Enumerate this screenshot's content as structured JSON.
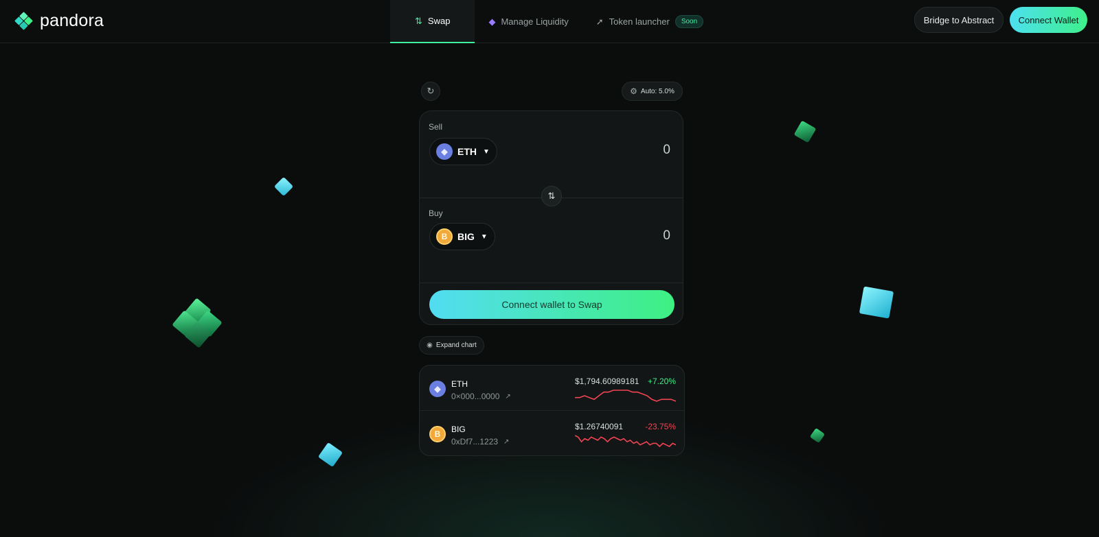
{
  "brand": {
    "name": "pandora"
  },
  "nav": {
    "items": [
      {
        "label": "Swap",
        "icon": "swap-arrows-icon",
        "active": true
      },
      {
        "label": "Manage Liquidity",
        "icon": "cube-icon",
        "active": false
      },
      {
        "label": "Token launcher",
        "icon": "rocket-icon",
        "active": false,
        "badge": "Soon"
      }
    ]
  },
  "header_actions": {
    "bridge_label": "Bridge to Abstract",
    "connect_label": "Connect Wallet"
  },
  "swap": {
    "slippage_label": "Auto: 5.0%",
    "sell": {
      "label": "Sell",
      "token": "ETH",
      "amount": "0"
    },
    "buy": {
      "label": "Buy",
      "token": "BIG",
      "amount": "0"
    },
    "cta_label": "Connect wallet to Swap"
  },
  "chart_toggle": {
    "label": "Expand chart"
  },
  "tokens": [
    {
      "symbol": "ETH",
      "address": "0×000...0000",
      "price": "$1,794.60989181",
      "change": "+7.20%",
      "trend": "up",
      "sparkline": [
        8,
        8,
        7,
        8,
        9,
        7,
        5,
        5,
        4,
        4,
        4,
        4,
        5,
        5,
        6,
        7,
        9,
        10,
        9,
        9,
        9,
        10
      ]
    },
    {
      "symbol": "BIG",
      "address": "0xDf7...1223",
      "price": "$1.26740091",
      "change": "-23.75%",
      "trend": "down",
      "sparkline": [
        4,
        5,
        8,
        6,
        7,
        5,
        6,
        7,
        5,
        6,
        8,
        6,
        5,
        6,
        7,
        6,
        8,
        7,
        9,
        8,
        10,
        9,
        8,
        10,
        9,
        9,
        11,
        9,
        10,
        11,
        9,
        10
      ]
    }
  ],
  "colors": {
    "accent": "#3ef08a",
    "accent_cyan": "#4de0f0",
    "up": "#3ef08a",
    "down": "#f04452",
    "card_bg": "#131616",
    "page_bg": "#0b0d0d"
  }
}
